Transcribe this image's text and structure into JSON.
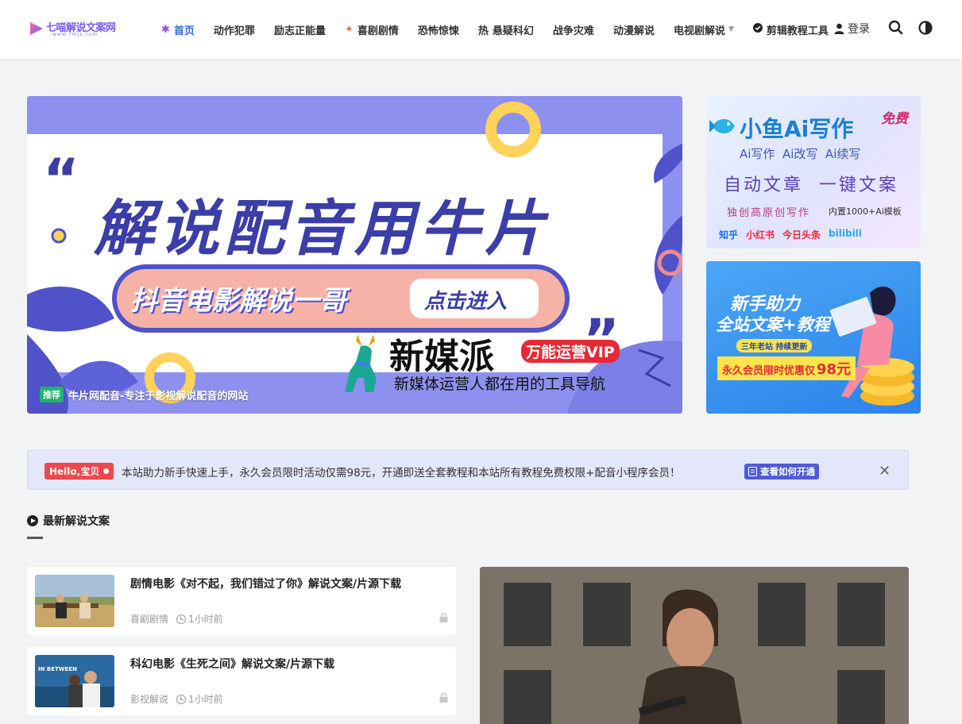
{
  "header": {
    "logo_text": "七喵解说文案网",
    "logo_sub": "www.7mjs.com",
    "nav": [
      {
        "label": "首页",
        "icon": "asterisk-icon",
        "active": true
      },
      {
        "label": "动作犯罪"
      },
      {
        "label": "励志正能量"
      },
      {
        "label": "喜剧剧情",
        "icon": "spark-icon"
      },
      {
        "label": "恐怖惊悚"
      },
      {
        "label": "悬疑科幻",
        "prefix": "热"
      },
      {
        "label": "战争灾难"
      },
      {
        "label": "动漫解说"
      },
      {
        "label": "电视剧解说",
        "dropdown": true
      },
      {
        "label": "剪辑教程工具",
        "icon": "check-circle-icon"
      }
    ],
    "login_label": "登录",
    "accent_color": "#2f6bd8"
  },
  "hero": {
    "banner_quote_open": "“",
    "banner_quote_close": "”",
    "banner_main": "解说配音用牛片",
    "banner_pill": "抖音电影解说一哥",
    "banner_cta": "点击进入",
    "brand_name": "新媒派",
    "brand_badge": "万能运营VIP",
    "brand_slogan": "新媒体运营人都在用的工具导航",
    "tag": "推荐",
    "caption": "牛片网配音-专注于影视解说配音的网站"
  },
  "ad1": {
    "title": "小鱼Ai写作",
    "free": "免费",
    "line1": "Ai写作  Ai改写  Ai续写",
    "line2": "自动文章  一键文案",
    "line3": "独创高原创写作",
    "line3b": "内置1000+Ai模板",
    "platforms": [
      "知乎",
      "小红书",
      "今日头条",
      "bilibili"
    ]
  },
  "ad2": {
    "line1": "新手助力",
    "line2": "全站文案+教程",
    "badge": "三年老站 持续更新",
    "promo_prefix": "永久会员限时优惠仅",
    "promo_price": "98元"
  },
  "notice": {
    "hello": "Hello,宝贝",
    "text": "本站助力新手快速上手，永久会员限时活动仅需98元，开通即送全套教程和本站所有教程免费权限+配音小程序会员！",
    "button": "查看如何开通",
    "close": "✕"
  },
  "section": {
    "title": "最新解说文案"
  },
  "posts": [
    {
      "title": "剧情电影《对不起，我们错过了你》解说文案/片源下载",
      "category": "喜剧剧情",
      "time": "1小时前"
    },
    {
      "title": "科幻电影《生死之间》解说文案/片源下载",
      "category": "影视解说",
      "time": "1小时前",
      "thumb_text": "IN BETWEEN"
    }
  ]
}
